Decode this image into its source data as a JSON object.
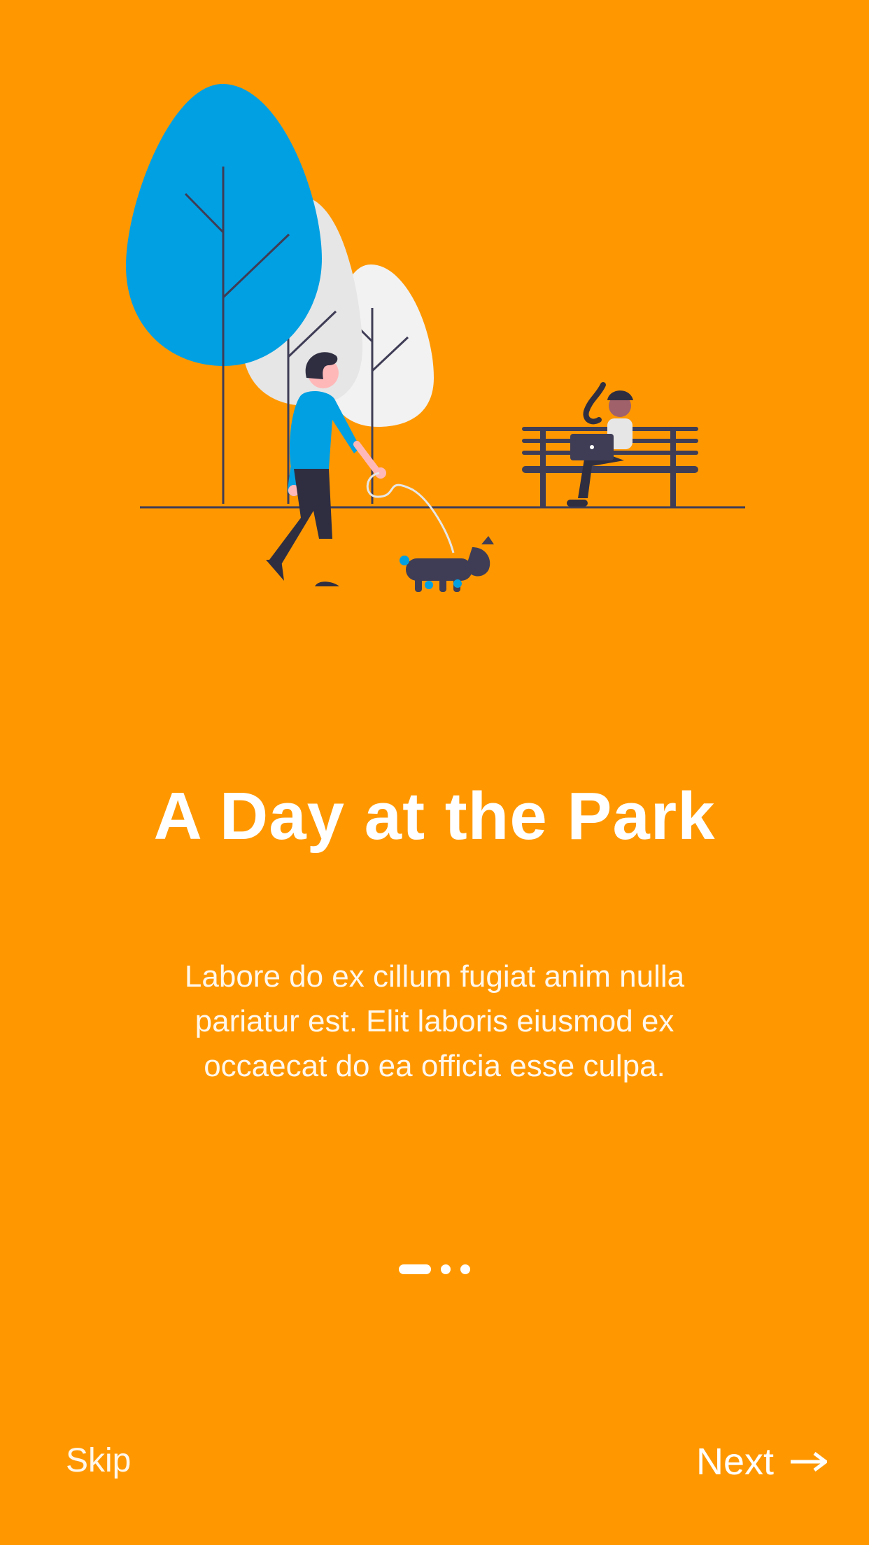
{
  "screen": {
    "background_color": "#FF9800",
    "accent_color": "#00A0E3"
  },
  "onboarding": {
    "title": "A Day at the Park",
    "description": "Labore do ex cillum fugiat anim nulla pariatur est. Elit laboris eiusmod ex occaecat do ea officia esse culpa.",
    "illustration_icon": "park-scene-illustration",
    "pager": {
      "total_pages": 3,
      "current_page": 1
    }
  },
  "footer": {
    "skip_label": "Skip",
    "next_label": "Next",
    "next_icon": "arrow-right-icon"
  }
}
